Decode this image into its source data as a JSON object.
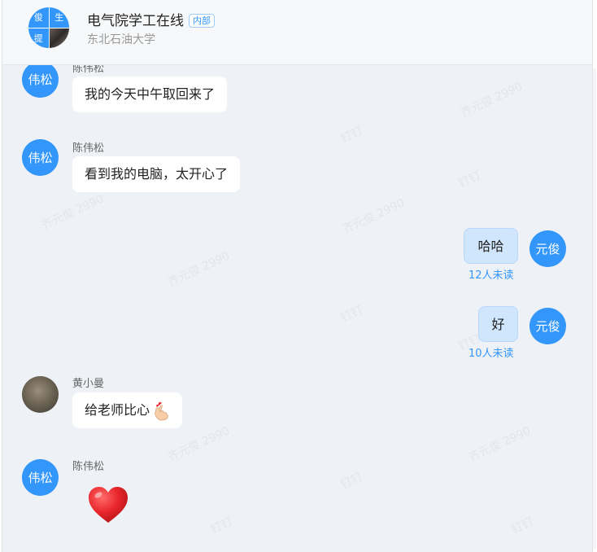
{
  "header": {
    "title": "电气院学工在线",
    "tag": "内部",
    "subtitle": "东北石油大学",
    "avatar_cells": [
      "俊",
      "生",
      "提"
    ]
  },
  "watermark": "齐元俊 2990",
  "watermark_short": "钉钉",
  "messages": [
    {
      "sender": "陈伟松",
      "avatar_text": "伟松",
      "text": "我的今天中午取回来了"
    },
    {
      "sender": "陈伟松",
      "avatar_text": "伟松",
      "text": "看到我的电脑，太开心了"
    },
    {
      "avatar_text": "元俊",
      "text": "哈哈",
      "read_status": "12人未读"
    },
    {
      "avatar_text": "元俊",
      "text": "好",
      "read_status": "10人未读"
    },
    {
      "sender": "黄小曼",
      "text": "给老师比心",
      "emoji": "finger-heart-icon"
    },
    {
      "sender": "陈伟松",
      "avatar_text": "伟松",
      "emoji": "red-heart-icon"
    }
  ],
  "colors": {
    "accent": "#3296fa",
    "chat_bg": "#eef1f5",
    "my_bubble": "#cfe6fd",
    "heart": "#e8262b"
  }
}
